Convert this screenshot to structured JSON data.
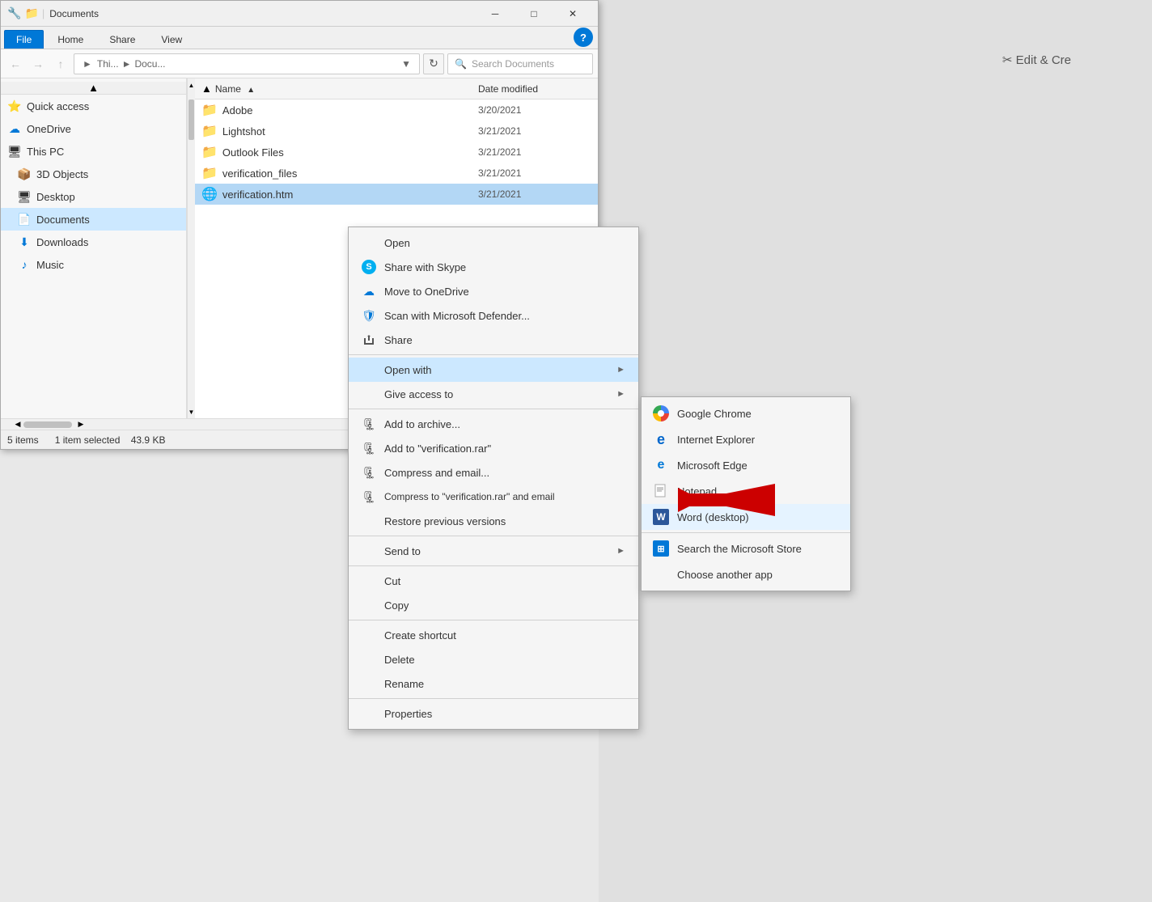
{
  "window": {
    "title": "Documents",
    "title_path": "▶ Documents"
  },
  "ribbon": {
    "tabs": [
      "File",
      "Home",
      "Share",
      "View"
    ]
  },
  "addressbar": {
    "path_parts": [
      "Thi...",
      "Docu..."
    ],
    "search_placeholder": "Search Documents"
  },
  "sidebar": {
    "items": [
      {
        "id": "quick-access",
        "label": "Quick access",
        "icon": "⭐",
        "indent": 0,
        "active": false
      },
      {
        "id": "onedrive",
        "label": "OneDrive",
        "icon": "☁",
        "indent": 0,
        "active": false
      },
      {
        "id": "this-pc",
        "label": "This PC",
        "icon": "🖥",
        "indent": 0,
        "active": false
      },
      {
        "id": "3d-objects",
        "label": "3D Objects",
        "icon": "📦",
        "indent": 1,
        "active": false
      },
      {
        "id": "desktop",
        "label": "Desktop",
        "icon": "🖥",
        "indent": 1,
        "active": false
      },
      {
        "id": "documents",
        "label": "Documents",
        "icon": "📄",
        "indent": 1,
        "active": true
      },
      {
        "id": "downloads",
        "label": "Downloads",
        "icon": "⬇",
        "indent": 1,
        "active": false
      },
      {
        "id": "music",
        "label": "Music",
        "icon": "♪",
        "indent": 1,
        "active": false
      }
    ]
  },
  "files": {
    "columns": [
      "Name",
      "Date modified"
    ],
    "items": [
      {
        "name": "Adobe",
        "type": "folder",
        "date": "3/20/2021"
      },
      {
        "name": "Lightshot",
        "type": "folder",
        "date": "3/21/2021"
      },
      {
        "name": "Outlook Files",
        "type": "folder",
        "date": "3/21/2021"
      },
      {
        "name": "verification_files",
        "type": "folder",
        "date": "3/21/2021"
      },
      {
        "name": "verification.htm",
        "type": "html",
        "date": "3/21/2021"
      }
    ]
  },
  "statusbar": {
    "count": "5 items",
    "selected": "1 item selected",
    "size": "43.9 KB"
  },
  "context_menu": {
    "items": [
      {
        "id": "open",
        "label": "Open",
        "icon": ""
      },
      {
        "id": "share-skype",
        "label": "Share with Skype",
        "icon": "S",
        "icon_type": "skype"
      },
      {
        "id": "move-onedrive",
        "label": "Move to OneDrive",
        "icon": "☁",
        "icon_type": "onedrive"
      },
      {
        "id": "scan-defender",
        "label": "Scan with Microsoft Defender...",
        "icon": "🛡",
        "icon_type": "defender"
      },
      {
        "id": "share",
        "label": "Share",
        "icon": "↗",
        "icon_type": "share"
      },
      {
        "id": "divider1",
        "type": "divider"
      },
      {
        "id": "open-with",
        "label": "Open with",
        "icon": "",
        "has_sub": true
      },
      {
        "id": "give-access",
        "label": "Give access to",
        "icon": "",
        "has_sub": true
      },
      {
        "id": "divider2",
        "type": "divider"
      },
      {
        "id": "add-archive",
        "label": "Add to archive...",
        "icon": "📦",
        "icon_type": "rar"
      },
      {
        "id": "add-verification-rar",
        "label": "Add to \"verification.rar\"",
        "icon": "📦",
        "icon_type": "rar"
      },
      {
        "id": "compress-email",
        "label": "Compress and email...",
        "icon": "📦",
        "icon_type": "rar"
      },
      {
        "id": "compress-rar-email",
        "label": "Compress to \"verification.rar\" and email",
        "icon": "📦",
        "icon_type": "rar"
      },
      {
        "id": "restore-versions",
        "label": "Restore previous versions",
        "icon": ""
      },
      {
        "id": "divider3",
        "type": "divider"
      },
      {
        "id": "send-to",
        "label": "Send to",
        "icon": "",
        "has_sub": true
      },
      {
        "id": "divider4",
        "type": "divider"
      },
      {
        "id": "cut",
        "label": "Cut",
        "icon": ""
      },
      {
        "id": "copy",
        "label": "Copy",
        "icon": ""
      },
      {
        "id": "divider5",
        "type": "divider"
      },
      {
        "id": "create-shortcut",
        "label": "Create shortcut",
        "icon": ""
      },
      {
        "id": "delete",
        "label": "Delete",
        "icon": ""
      },
      {
        "id": "rename",
        "label": "Rename",
        "icon": ""
      },
      {
        "id": "divider6",
        "type": "divider"
      },
      {
        "id": "properties",
        "label": "Properties",
        "icon": ""
      }
    ]
  },
  "submenu_openwith": {
    "items": [
      {
        "id": "chrome",
        "label": "Google Chrome",
        "icon_type": "chrome"
      },
      {
        "id": "ie",
        "label": "Internet Explorer",
        "icon_type": "ie"
      },
      {
        "id": "edge",
        "label": "Microsoft Edge",
        "icon_type": "edge"
      },
      {
        "id": "notepad",
        "label": "Notepad",
        "icon_type": "notepad"
      },
      {
        "id": "word",
        "label": "Word (desktop)",
        "icon_type": "word",
        "highlighted": true
      },
      {
        "id": "divider",
        "type": "divider"
      },
      {
        "id": "store",
        "label": "Search the Microsoft Store",
        "icon_type": "store"
      },
      {
        "id": "another",
        "label": "Choose another app",
        "icon_type": "none"
      }
    ]
  },
  "bg": {
    "edit_create_text": "✂ Edit & Cre"
  }
}
